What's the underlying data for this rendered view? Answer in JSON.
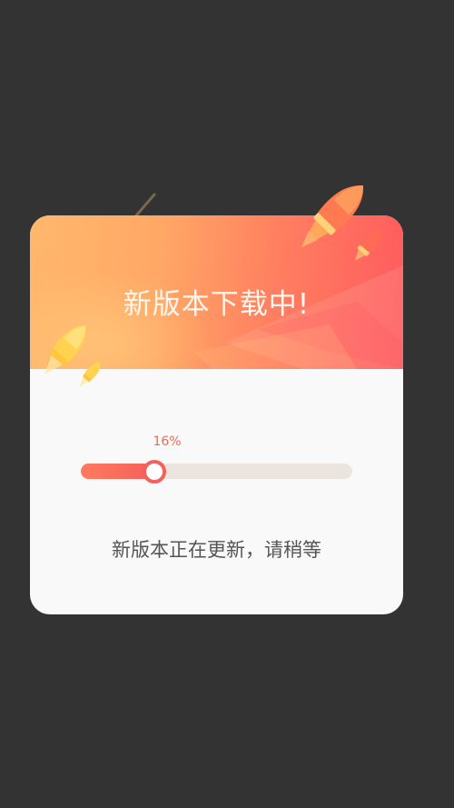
{
  "dialog": {
    "title": "新版本下载中!",
    "status_text": "新版本正在更新，请稍等"
  },
  "progress": {
    "label": "16%",
    "fraction": 0.27
  },
  "icons": [
    "rocket-icon-large",
    "rocket-icon-small",
    "rocket-icon-yellow",
    "rocket-icon-yellow-small"
  ],
  "colors": {
    "background": "#333333",
    "header_start": "#ffb86c",
    "header_end": "#ff5b5e",
    "accent": "#f4605a",
    "track": "#ece4de",
    "card": "#f9f9f9"
  }
}
